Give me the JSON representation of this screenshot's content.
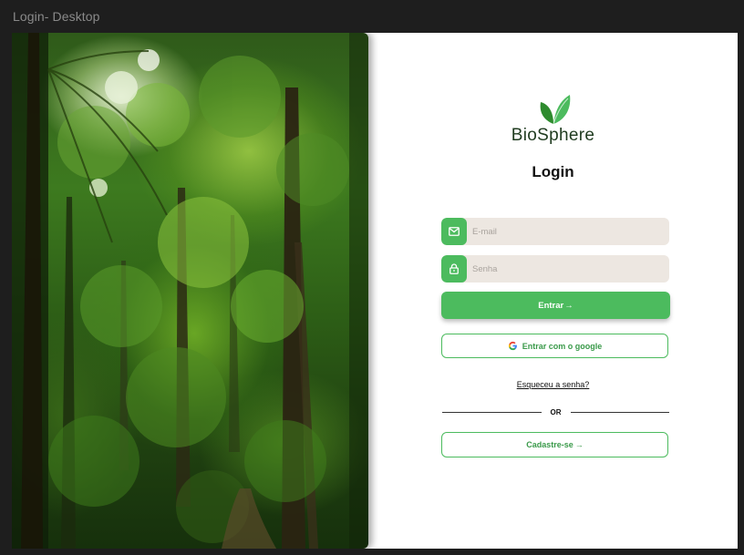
{
  "frame": {
    "title": "Login- Desktop"
  },
  "photo": {
    "description_icon": "forest-photo"
  },
  "brand": {
    "name": "BioSphere",
    "icon": "leaf-icon",
    "color": "#4cbb5e"
  },
  "login": {
    "heading": "Login",
    "email": {
      "placeholder": "E-mail",
      "value": "",
      "icon": "mail-icon"
    },
    "password": {
      "placeholder": "Senha",
      "value": "",
      "icon": "lock-icon"
    },
    "submit_label": "Entrar",
    "submit_arrow": "→",
    "google_label": "Entrar com o google",
    "google_icon": "google-icon",
    "forgot_label": "Esqueceu a senha?",
    "divider_text": "OR",
    "signup_label": "Cadastre-se",
    "signup_arrow": "→"
  },
  "colors": {
    "accent": "#4cbb5e",
    "field_bg": "#ede7e1",
    "background": "#1e1e1e"
  }
}
